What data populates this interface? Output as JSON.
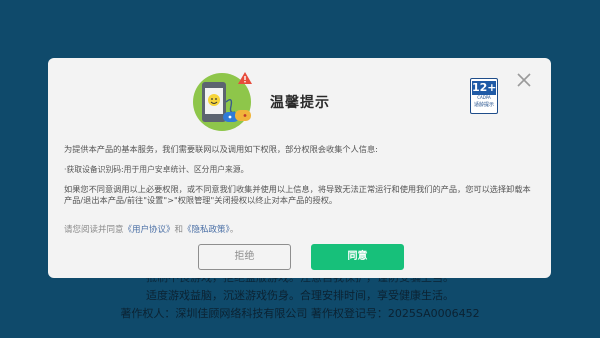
{
  "background": {
    "footer_line1": "抵制不良游戏，拒绝盗版游戏。注意自我保护，谨防受骗上当。",
    "footer_line2": "适度游戏益脑，沉迷游戏伤身。合理安排时间，享受健康生活。",
    "footer_line3": "著作权人：深圳佳顾网络科技有限公司    著作权登记号：2025SA0006452"
  },
  "dialog": {
    "title": "温馨提示",
    "age_rating": "12+",
    "age_org": "CADPA",
    "age_tip": "适龄提示",
    "paragraph1": "为提供本产品的基本服务，我们需要联网以及调用如下权限，部分权限会收集个人信息:",
    "paragraph2": "·获取设备识别码:用于用户安卓统计、区分用户来源。",
    "paragraph3": "如果您不同意调用以上必要权限，或不同意我们收集并使用以上信息，将导致无法正常运行和使用我们的产品，您可以选择卸载本产品/退出本产品/前往\"设置\">\"权限管理\"关闭授权以终止对本产品的授权。",
    "agree_prefix": "请您阅读并同意",
    "user_agreement": "《用户协议》",
    "and": "和",
    "privacy_policy": "《隐私政策》",
    "agree_suffix": "。",
    "reject_label": "拒绝",
    "accept_label": "同意"
  },
  "colors": {
    "background": "#0f4a6b",
    "dialog": "#f3f3f3",
    "accent": "#17c07a",
    "link": "#4a6fa5"
  },
  "icons": [
    "phone-permission-illustration",
    "close-icon",
    "age-rating-badge"
  ]
}
